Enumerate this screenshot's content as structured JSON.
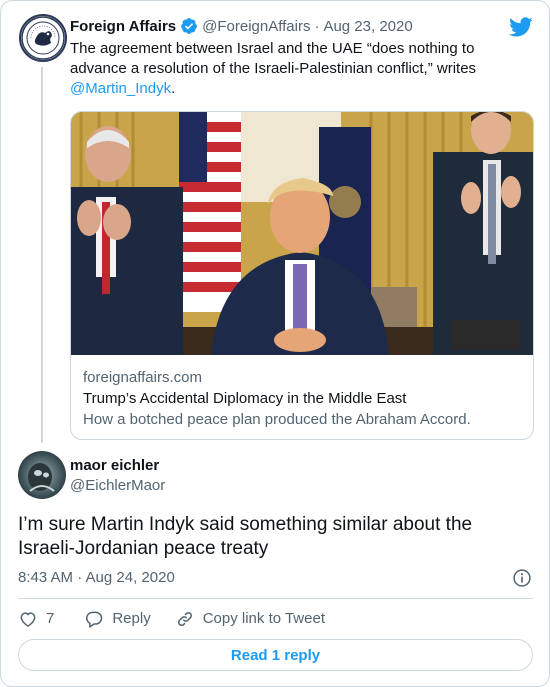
{
  "parent_tweet": {
    "author_name": "Foreign Affairs",
    "handle": "@ForeignAffairs",
    "separator": "·",
    "date": "Aug 23, 2020",
    "text": "The agreement between Israel and the UAE “does nothing to advance a resolution of the Israeli-Palestinian conflict,” writes ",
    "mention": "@Martin_Indyk",
    "text_end": ".",
    "verified_icon": "verified-badge-icon",
    "platform_icon": "twitter-bird-icon"
  },
  "link_card": {
    "domain": "foreignaffairs.com",
    "title": "Trump’s Accidental Diplomacy in the Middle East",
    "description": "How a botched peace plan produced the Abraham Accord."
  },
  "reply_tweet": {
    "author_name": "maor eichler",
    "handle": "@EichlerMaor",
    "text": "I’m sure Martin Indyk said something similar about the Israeli-Jordanian peace treaty",
    "timestamp": "8:43 AM · Aug 24, 2020"
  },
  "actions": {
    "like_count": "7",
    "reply_label": "Reply",
    "copy_link_label": "Copy link to Tweet"
  },
  "read_replies_label": "Read 1 reply",
  "colors": {
    "accent": "#1d9bf0",
    "text_primary": "#0f1419",
    "text_secondary": "#536471",
    "border": "#cfd9de"
  }
}
